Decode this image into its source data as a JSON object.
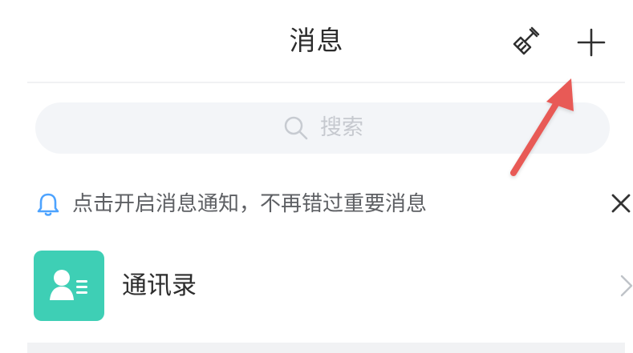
{
  "header": {
    "title": "消息",
    "broom_icon": "broom-icon",
    "plus_icon": "plus-icon"
  },
  "search": {
    "placeholder": "搜索",
    "icon": "search-icon"
  },
  "notice": {
    "icon": "bell-icon",
    "text": "点击开启消息通知，不再错过重要消息",
    "close_icon": "close-icon"
  },
  "contacts": {
    "label": "通讯录",
    "avatar_icon": "contacts-avatar-icon",
    "chevron_icon": "chevron-right-icon"
  },
  "colors": {
    "accent": "#3ecfb5",
    "bell": "#4da3ff",
    "annotation": "#e85a57",
    "search_bg": "#f3f5f8"
  }
}
